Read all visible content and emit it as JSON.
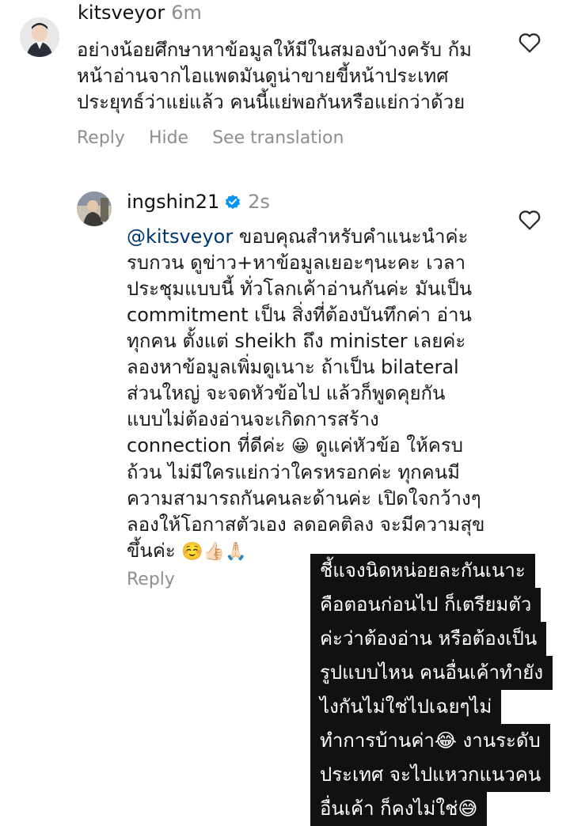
{
  "comment1": {
    "username": "kitsveyor",
    "time": "6m",
    "text": "อย่างน้อยศึกษาหาข้อมูลให้มีในสมองบ้างครับ ก้ม\nหน้าอ่านจากไอแพดมันดูน่าขายขี้หน้าประเทศ\nประยุทธ์ว่าแย่แล้ว คนนี้แย่พอกันหรือแย่กว่าด้วย",
    "actions": {
      "reply": "Reply",
      "hide": "Hide",
      "translate": "See translation"
    }
  },
  "reply1": {
    "username": "ingshin21",
    "time": "2s",
    "mention": "@kitsveyor",
    "text_part1": " ขอบคุณสำหรับคำแนะนำค่ะ\nรบกวน ดูข่าว+หาข้อมูลเยอะๆนะคะ เวลา\nประชุมแบบนี้ ทั่วโลกเค้าอ่านกันค่ะ มันเป็น\ncommitment เป็น สิ่งที่ต้องบันทึกค่า อ่าน\nทุกคน ตั้งแต่ sheikh ถึง minister เลยค่ะ\nลองหาข้อมูลเพิ่มดูเนาะ ถ้าเป็น bilateral\nส่วนใหญ่ จะจดหัวข้อไป แล้วก็พูดคุยกัน\nแบบไม่ต้องอ่านจะเกิดการสร้าง\nconnection ที่ดีค่ะ ",
    "emoji1": "😀",
    "text_part2": " ดูแค่หัวข้อ ให้ครบ\nถ้วน ไม่มีใครแย่กว่าใครหรอกค่ะ ทุกคนมี\nความสามารถกันคนละด้านค่ะ เปิดใจกว้างๆ\nลองให้โอกาสตัวเอง ลดอคติลง จะมีความสุข\nขึ้นค่ะ ",
    "emoji2": "☺️👍🏻🙏🏻",
    "actions": {
      "reply": "Reply"
    }
  },
  "overlay_lines": [
    "ชี้แจงนิดหน่อยละกันเนาะ",
    "คือตอนก่อนไป ก็เตรียมตัว",
    "ค่ะว่าต้องอ่าน หรือต้องเป็น",
    "รูปแบบไหน คนอื่นเค้าทำยัง",
    "ไงกันไม่ใช่ไปเฉยๆไม่",
    "ทำการบ้านค่า😂 งานระดับ",
    "ประเทศ จะไปแหวกแนวคน",
    "อื่นเค้า ก็คงไม่ใช่😅"
  ],
  "colors": {
    "mention": "#00376b",
    "verified": "#0095f6",
    "meta": "#8e8e8e",
    "overlay_bg": "#111111"
  }
}
